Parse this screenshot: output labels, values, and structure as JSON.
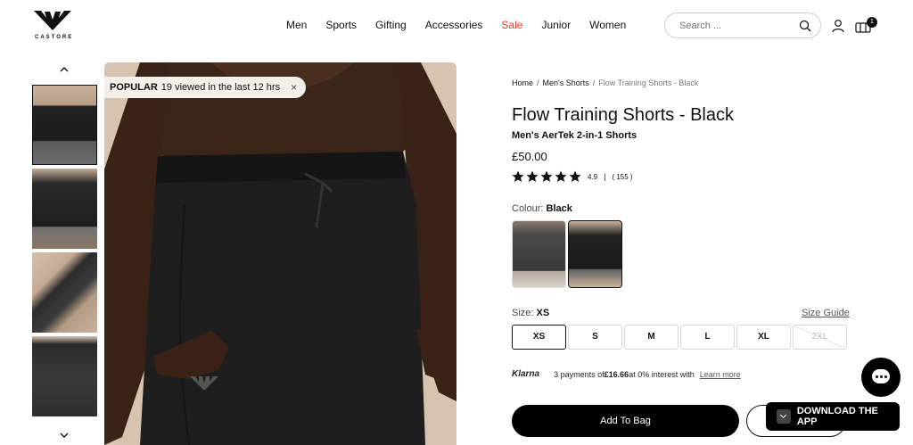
{
  "brand": {
    "name": "CASTORE"
  },
  "nav": {
    "items": [
      "Men",
      "Sports",
      "Gifting",
      "Accessories",
      "Sale",
      "Junior",
      "Women"
    ]
  },
  "search": {
    "placeholder": "Search ..."
  },
  "cart": {
    "count": "1"
  },
  "gallery": {
    "popular_label": "POPULAR",
    "popular_text": "19 viewed in the last 12 hrs",
    "close_glyph": "×"
  },
  "breadcrumb": {
    "items": [
      "Home",
      "Men's Shorts",
      "Flow Training Shorts - Black"
    ]
  },
  "product": {
    "title": "Flow Training Shorts - Black",
    "subtitle": "Men's AerTek 2-in-1 Shorts",
    "price": "£50.00",
    "rating": "4.9",
    "rating_sep": "|",
    "reviews": "( 155 )",
    "stars": 5,
    "colour_label": "Colour:",
    "colour_value": "Black",
    "size_label": "Size:",
    "size_value": "XS",
    "size_guide": "Size Guide",
    "sizes": [
      "XS",
      "S",
      "M",
      "L",
      "XL",
      "2XL"
    ]
  },
  "klarna": {
    "logo": "Klarna",
    "text_pre": "3 payments of",
    "amount": "£16.66",
    "text_post": "at 0% interest with",
    "learn_more": "Learn more"
  },
  "actions": {
    "add_to_bag": "Add To Bag",
    "download_app": "DOWNLOAD THE APP"
  },
  "colors": {
    "sale": "#e23d1f",
    "primary": "#000000"
  }
}
